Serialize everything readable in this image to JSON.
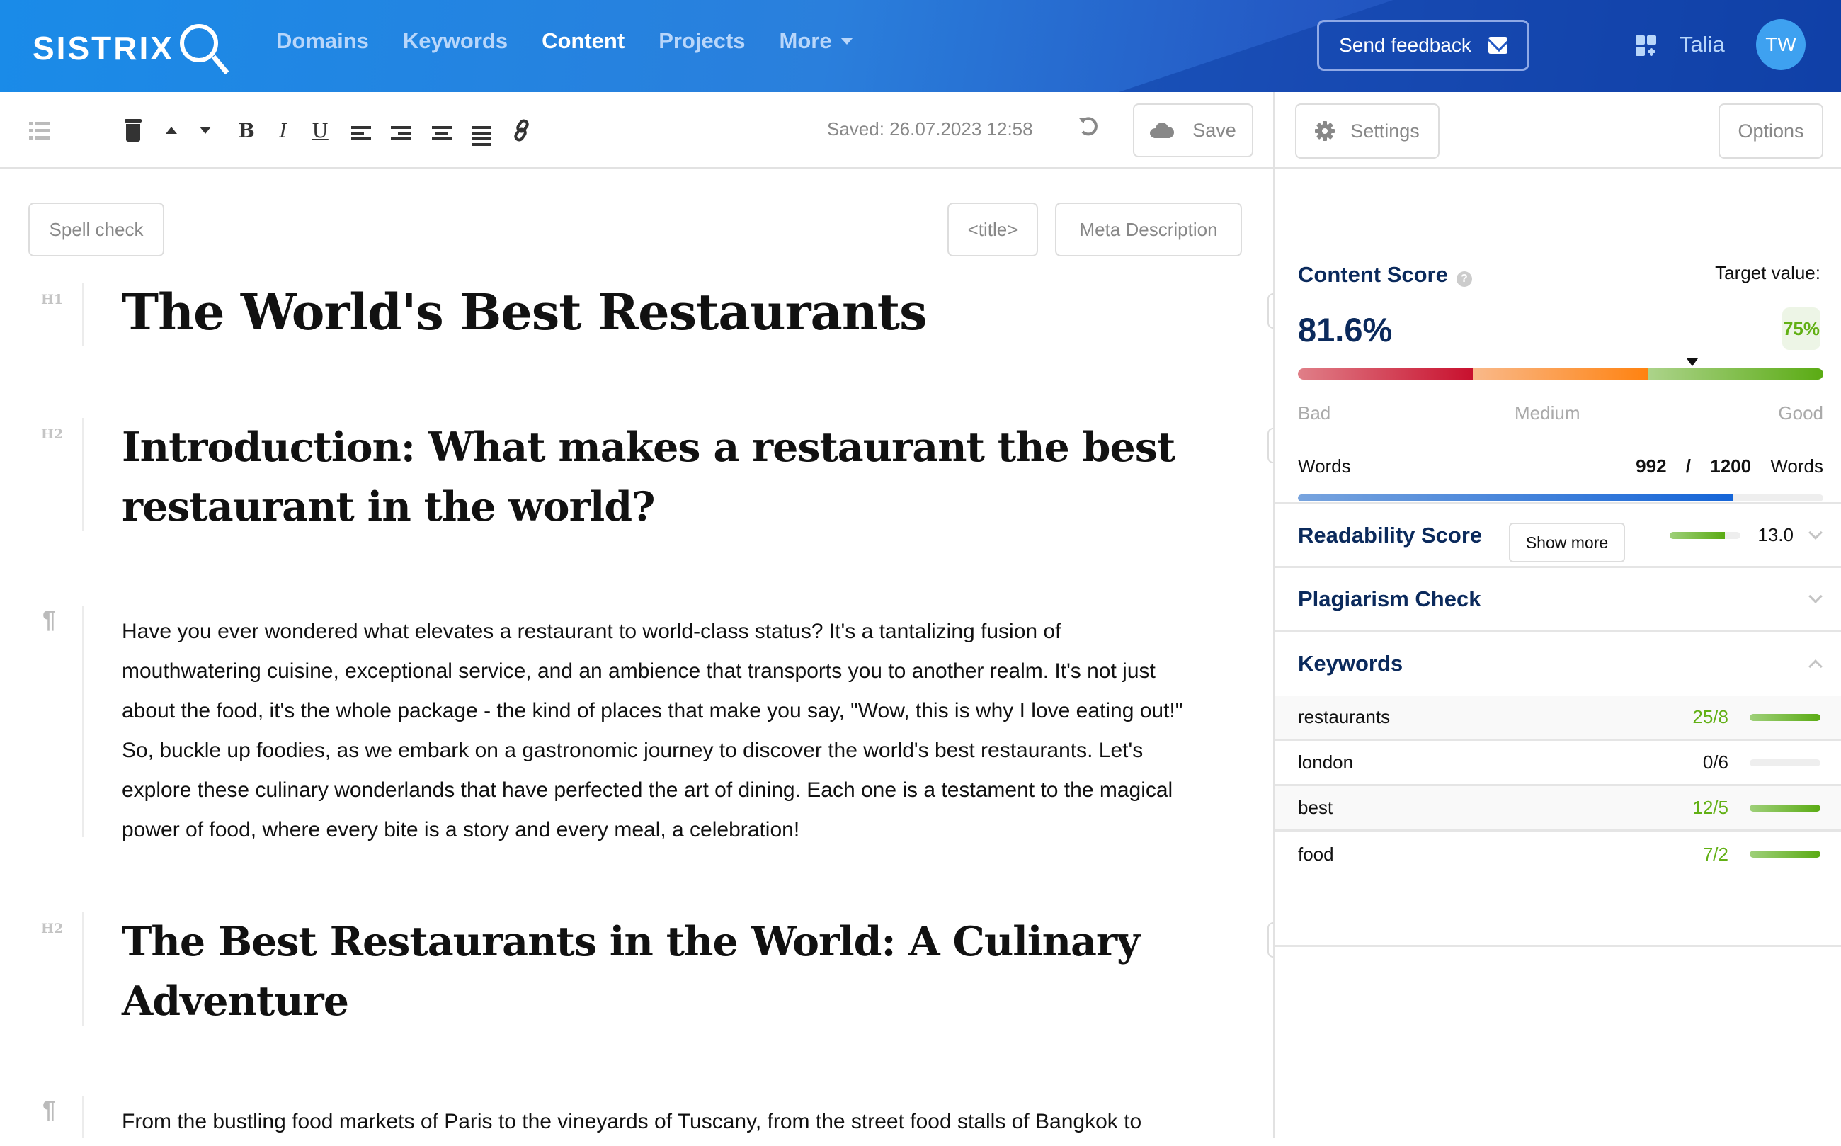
{
  "header": {
    "logo": "SISTRIX",
    "nav": [
      {
        "label": "Domains",
        "active": false
      },
      {
        "label": "Keywords",
        "active": false
      },
      {
        "label": "Content",
        "active": true
      },
      {
        "label": "Projects",
        "active": false
      },
      {
        "label": "More",
        "active": false,
        "has_dropdown": true
      }
    ],
    "feedback_label": "Send feedback",
    "user_name": "Talia",
    "avatar_initials": "TW"
  },
  "toolbar": {
    "icons": [
      "outline-list-icon",
      "delete-icon",
      "move-up-icon",
      "move-down-icon",
      "bold-icon",
      "italic-icon",
      "underline-icon",
      "align-left-icon",
      "align-right-icon",
      "align-center-icon",
      "align-justify-icon",
      "link-icon"
    ],
    "bold": "B",
    "italic": "I",
    "underline": "U",
    "saved_text": "Saved: 26.07.2023 12:58",
    "save_label": "Save"
  },
  "editor": {
    "spell_check_label": "Spell check",
    "title_tag_label": "<title>",
    "meta_description_label": "Meta Description",
    "blocks": [
      {
        "tag": "H1",
        "text": "The World's Best Restaurants"
      },
      {
        "tag": "H2",
        "text": "Introduction: What makes a restaurant the best restaurant in the world?"
      },
      {
        "tag": "¶",
        "text": "Have you ever wondered what elevates a restaurant to world-class status? It's a tantalizing fusion of mouthwatering cuisine, exceptional service, and an ambience that transports you to another realm. It's not just about the food, it's the whole package - the kind of places that make you say, \"Wow, this is why I love eating out!\" So, buckle up foodies, as we embark on a gastronomic journey to discover the world's best restaurants. Let's explore these culinary wonderlands that have perfected the art of dining. Each one is a testament to the magical power of food, where every bite is a story and every meal, a celebration!"
      },
      {
        "tag": "H2",
        "text": "The Best Restaurants in the World: A Culinary Adventure"
      },
      {
        "tag": "¶",
        "text": "From the bustling food markets of Paris to the vineyards of Tuscany, from the street food stalls of Bangkok to"
      }
    ]
  },
  "sidebar": {
    "settings_label": "Settings",
    "options_label": "Options",
    "content_score": {
      "title": "Content Score",
      "help": "?",
      "value": "81.6%",
      "value_pct": 81.6,
      "target_label": "Target value:",
      "target_value": "75%",
      "target_pct": 75,
      "scale_labels": [
        "Bad",
        "Medium",
        "Good"
      ],
      "colors": {
        "bad": "#c8102e",
        "medium": "#ff8210",
        "good": "#62b015"
      }
    },
    "words": {
      "label": "Words",
      "current": "992",
      "separator": "/",
      "target": "1200",
      "unit": "Words",
      "progress": 0.827
    },
    "show_more_label": "Show more",
    "readability": {
      "title": "Readability Score",
      "value": "13.0",
      "progress": 0.78
    },
    "plagiarism": {
      "title": "Plagiarism Check"
    },
    "keywords": {
      "title": "Keywords",
      "items": [
        {
          "name": "restaurants",
          "count": "25/8",
          "met": true,
          "progress": 1.0
        },
        {
          "name": "london",
          "count": "0/6",
          "met": false,
          "progress": 0.0
        },
        {
          "name": "best",
          "count": "12/5",
          "met": true,
          "progress": 1.0
        },
        {
          "name": "food",
          "count": "7/2",
          "met": true,
          "progress": 1.0
        }
      ]
    }
  },
  "colors": {
    "navy": "#0b2a5c",
    "green": "#62b015",
    "blue_progress": "#1565d8",
    "header_blue": "#1a8be8"
  }
}
